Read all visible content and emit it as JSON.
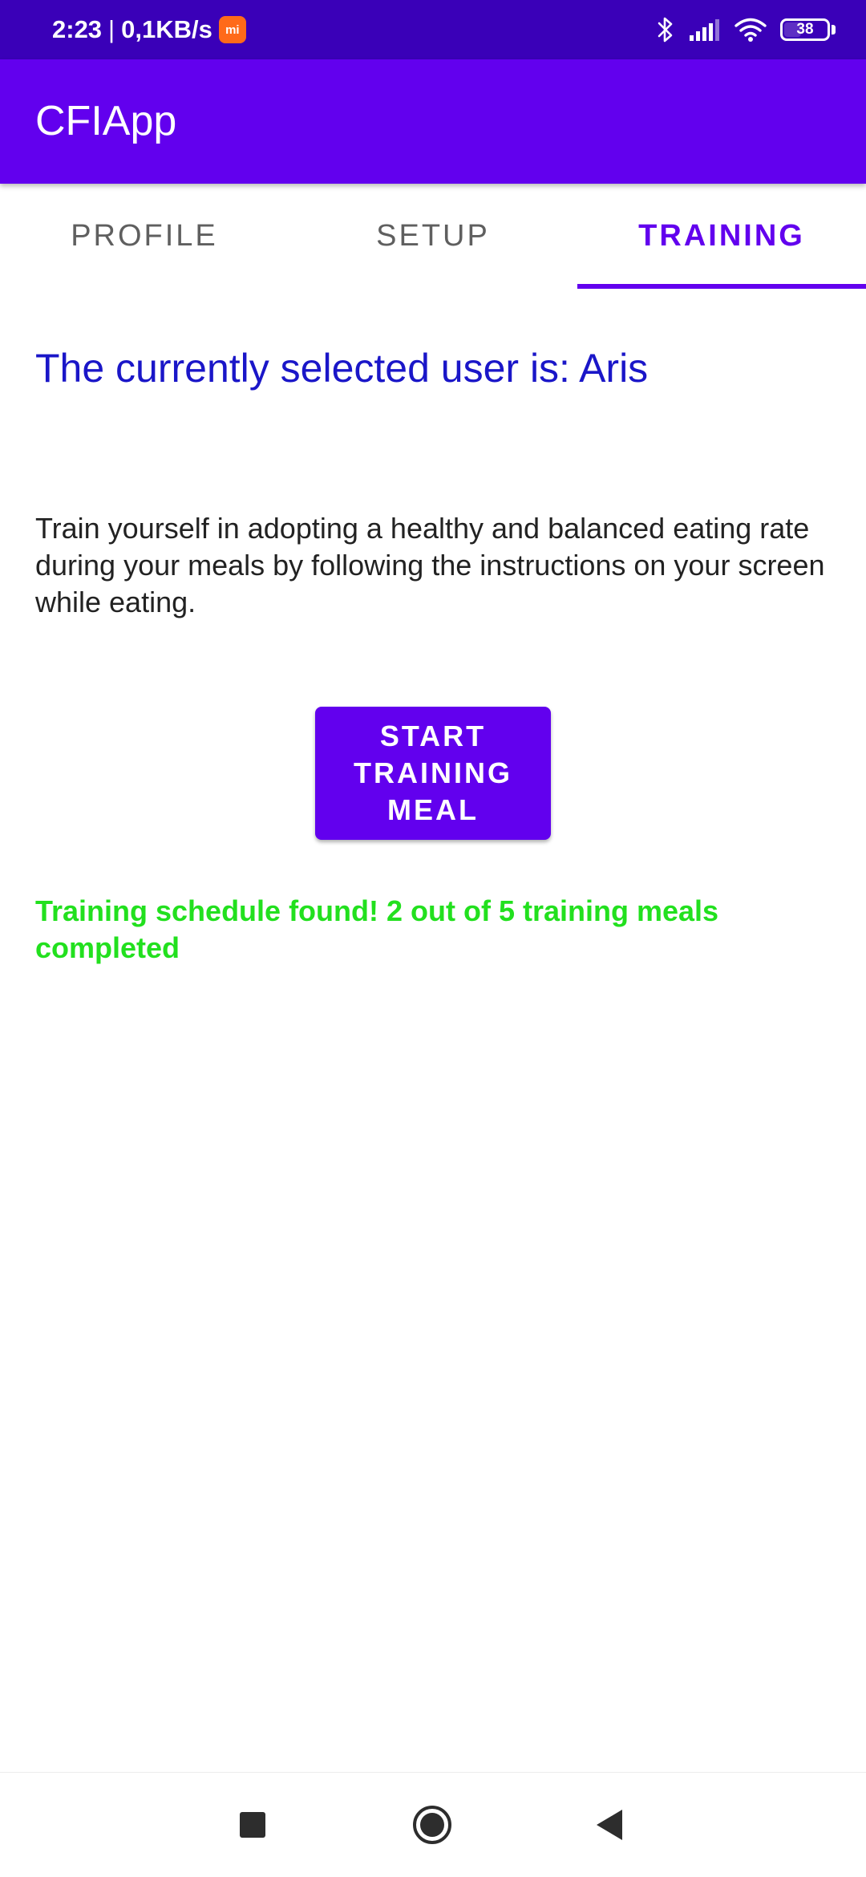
{
  "status_bar": {
    "time": "2:23",
    "separator": "|",
    "network_speed": "0,1KB/s",
    "notification_badge": "mi",
    "battery_level": "38",
    "icons": [
      "bluetooth-icon",
      "signal-icon",
      "wifi-icon",
      "battery-icon"
    ]
  },
  "app_bar": {
    "title": "CFIApp"
  },
  "tabs": [
    {
      "label": "PROFILE",
      "active": false
    },
    {
      "label": "SETUP",
      "active": false
    },
    {
      "label": "TRAINING",
      "active": true
    }
  ],
  "training": {
    "current_user_text": "The currently selected user is: Aris",
    "description": "Train yourself in adopting a healthy and balanced eating rate during your meals by following the instructions on your screen while eating.",
    "start_button_label": "START TRAINING MEAL",
    "schedule_status": "Training schedule found! 2 out of 5 training meals completed"
  },
  "nav_bar": {
    "buttons": [
      "recents-icon",
      "home-icon",
      "back-icon"
    ]
  },
  "colors": {
    "status_bar": "#3a00b8",
    "primary": "#6200ee",
    "user_text": "#1a16c8",
    "success_text": "#22e01e",
    "inactive_tab": "#5f5f5f"
  }
}
